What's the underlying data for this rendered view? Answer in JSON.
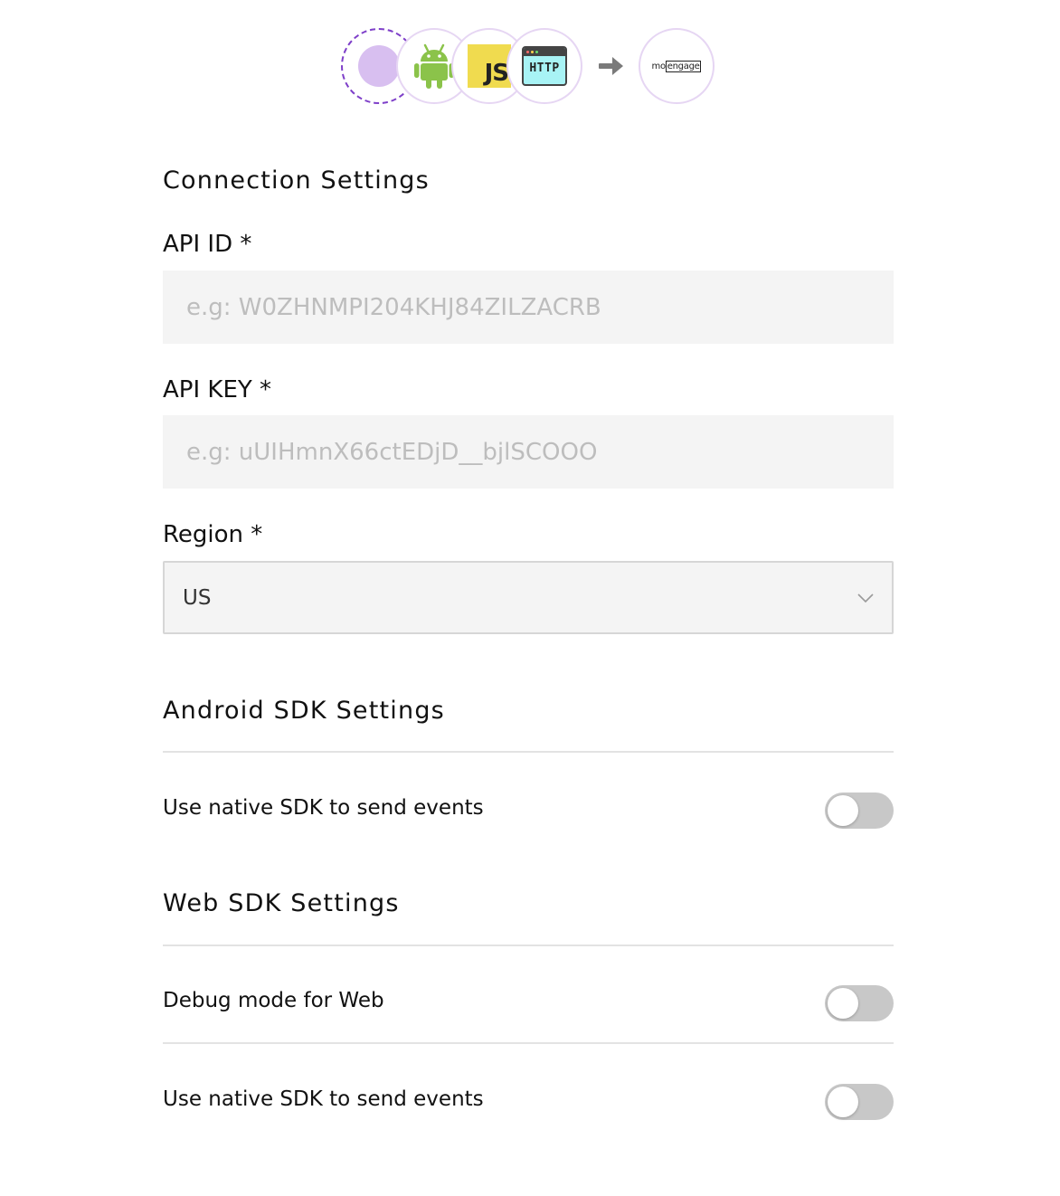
{
  "header": {
    "sources": [
      {
        "name": "add-source",
        "icon": "add-source-icon"
      },
      {
        "name": "Android",
        "icon": "android-icon"
      },
      {
        "name": "JavaScript",
        "icon": "javascript-icon",
        "glyph": "JS"
      },
      {
        "name": "HTTP",
        "icon": "http-icon",
        "glyph": "HTTP"
      }
    ],
    "arrow_icon": "arrow-right-icon",
    "destination": {
      "icon": "moengage-logo",
      "text_pre": "mo",
      "text_box": "engage"
    }
  },
  "connection": {
    "title": "Connection Settings",
    "api_id": {
      "label": "API ID *",
      "value": "",
      "placeholder": "e.g: W0ZHNMPI204KHJ84ZILZACRB"
    },
    "api_key": {
      "label": "API KEY *",
      "value": "",
      "placeholder": "e.g: uUIHmnX66ctEDjD__bjlSCOOO"
    },
    "region": {
      "label": "Region *",
      "selected": "US",
      "chevron_icon": "chevron-down-icon"
    }
  },
  "android_sdk": {
    "title": "Android SDK Settings",
    "settings": [
      {
        "label": "Use native SDK to send events",
        "enabled": false
      }
    ]
  },
  "web_sdk": {
    "title": "Web SDK Settings",
    "settings": [
      {
        "label": "Debug mode for Web",
        "enabled": false
      },
      {
        "label": "Use native SDK to send events",
        "enabled": false
      }
    ]
  },
  "colors": {
    "accent": "#7e3fc9",
    "accent_light": "#d8bff0",
    "bubble_border": "#e6d6f3",
    "input_bg": "#f4f4f4",
    "toggle_off": "#c8c8c8",
    "android_green": "#8bc34a",
    "js_yellow": "#f0db4f",
    "http_cyan": "#a8f3f5"
  }
}
